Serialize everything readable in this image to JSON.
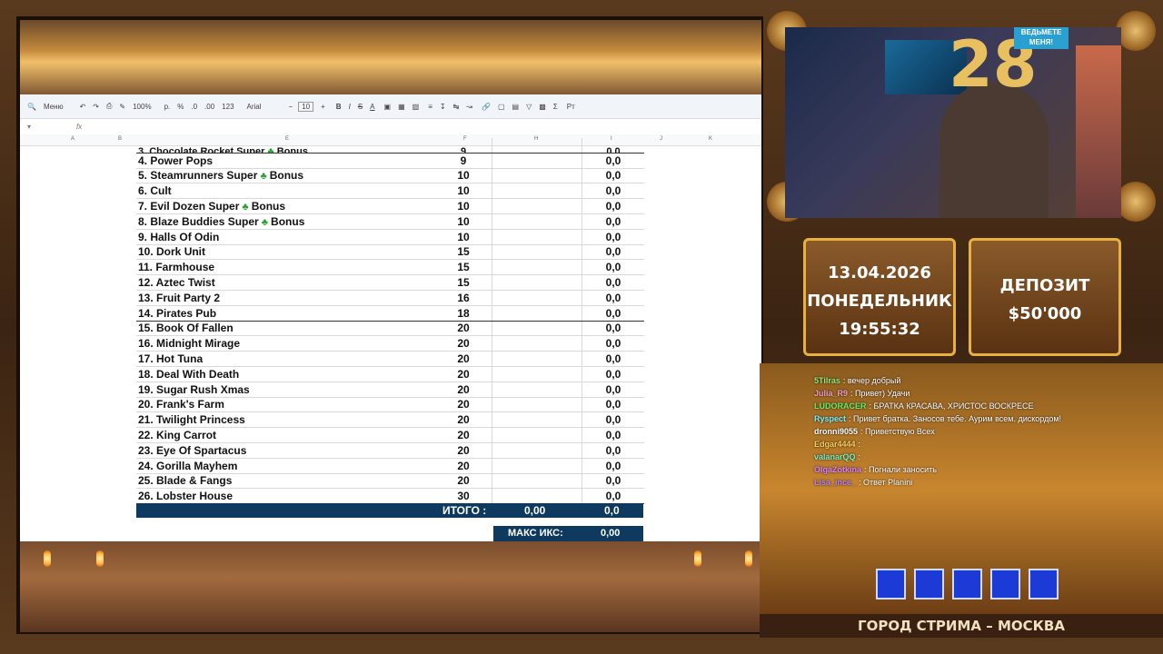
{
  "toolbar": {
    "menu_label": "Меню",
    "zoom": "100%",
    "font": "Arial",
    "font_size": "10",
    "format_123": "123"
  },
  "formula_bar": {
    "fx": "fx"
  },
  "columns": [
    "A",
    "B",
    "E",
    "F",
    "H",
    "I",
    "J",
    "K"
  ],
  "rows": [
    {
      "name": "3. Chocolate Rocket Super",
      "bonus": true,
      "bet": "9",
      "win": "",
      "x": "0,0",
      "partial": true
    },
    {
      "name": "4. Power Pops",
      "bonus": false,
      "bet": "9",
      "win": "",
      "x": "0,0"
    },
    {
      "name": "5. Steamrunners Super",
      "bonus": true,
      "bet": "10",
      "win": "",
      "x": "0,0"
    },
    {
      "name": "6. Cult",
      "bonus": false,
      "bet": "10",
      "win": "",
      "x": "0,0"
    },
    {
      "name": "7. Evil Dozen Super",
      "bonus": true,
      "bet": "10",
      "win": "",
      "x": "0,0"
    },
    {
      "name": "8. Blaze Buddies Super",
      "bonus": true,
      "bet": "10",
      "win": "",
      "x": "0,0"
    },
    {
      "name": "9. Halls Of Odin",
      "bonus": false,
      "bet": "10",
      "win": "",
      "x": "0,0"
    },
    {
      "name": "10. Dork Unit",
      "bonus": false,
      "bet": "15",
      "win": "",
      "x": "0,0"
    },
    {
      "name": "11. Farmhouse",
      "bonus": false,
      "bet": "15",
      "win": "",
      "x": "0,0"
    },
    {
      "name": "12. Aztec Twist",
      "bonus": false,
      "bet": "15",
      "win": "",
      "x": "0,0"
    },
    {
      "name": "13. Fruit Party 2",
      "bonus": false,
      "bet": "16",
      "win": "",
      "x": "0,0"
    },
    {
      "name": "14. Pirates Pub",
      "bonus": false,
      "bet": "18",
      "win": "",
      "x": "0,0"
    },
    {
      "name": "15. Book Of Fallen",
      "bonus": false,
      "bet": "20",
      "win": "",
      "x": "0,0"
    },
    {
      "name": "16. Midnight Mirage",
      "bonus": false,
      "bet": "20",
      "win": "",
      "x": "0,0"
    },
    {
      "name": "17. Hot Tuna",
      "bonus": false,
      "bet": "20",
      "win": "",
      "x": "0,0"
    },
    {
      "name": "18. Deal With Death",
      "bonus": false,
      "bet": "20",
      "win": "",
      "x": "0,0"
    },
    {
      "name": "19. Sugar Rush Xmas",
      "bonus": false,
      "bet": "20",
      "win": "",
      "x": "0,0"
    },
    {
      "name": "20. Frank's Farm",
      "bonus": false,
      "bet": "20",
      "win": "",
      "x": "0,0"
    },
    {
      "name": "21. Twilight Princess",
      "bonus": false,
      "bet": "20",
      "win": "",
      "x": "0,0"
    },
    {
      "name": "22. King Carrot",
      "bonus": false,
      "bet": "20",
      "win": "",
      "x": "0,0"
    },
    {
      "name": "23. Eye Of Spartacus",
      "bonus": false,
      "bet": "20",
      "win": "",
      "x": "0,0"
    },
    {
      "name": "24. Gorilla Mayhem",
      "bonus": false,
      "bet": "20",
      "win": "",
      "x": "0,0"
    },
    {
      "name": "25. Blade & Fangs",
      "bonus": false,
      "bet": "20",
      "win": "",
      "x": "0,0"
    },
    {
      "name": "26. Lobster House",
      "bonus": false,
      "bet": "30",
      "win": "",
      "x": "0,0"
    }
  ],
  "bonus_word": "Bonus",
  "totals": {
    "label": "ИТОГО :",
    "sum": "0,00",
    "x": "0,0"
  },
  "max_x": {
    "label": "МАКС ИКС:",
    "value": "0,00"
  },
  "webcam": {
    "balloon": "28",
    "sign": "ВЕДЬМЕТЕ МЕНЯ!"
  },
  "date_panel": {
    "date": "13.04.2026",
    "weekday": "ПОНЕДЕЛЬНИК",
    "time": "19:55:32"
  },
  "deposit_panel": {
    "label": "ДЕПОЗИТ",
    "amount": "$50'000"
  },
  "chat": [
    {
      "user": "5Tilras",
      "text": "вечер добрый",
      "color": "#8cf07a"
    },
    {
      "user": "Julia_R9",
      "text": "Привет) Удачи",
      "color": "#f0a0c0"
    },
    {
      "user": "LUDORACER",
      "text": "БРАТКА КРАСАВА, ХРИСТОС ВОСКРЕСЕ",
      "color": "#6af06a"
    },
    {
      "user": "Ryspect",
      "text": "Привет братка. Заносов тебе. Аурим всем. дискордом!",
      "color": "#7af0ff"
    },
    {
      "user": "dronni9055",
      "text": "Приветствую Всех",
      "color": "#ffffff"
    },
    {
      "user": "Edgar4444",
      "text": "",
      "color": "#ffd060"
    },
    {
      "user": "valanarQQ",
      "text": "",
      "color": "#7af0c0"
    },
    {
      "user": "OlgaZotkina",
      "text": "Погнали заносить",
      "color": "#e080ff"
    },
    {
      "user": "Lisa_ince_",
      "text": "Ответ Planini",
      "color": "#c080ff"
    }
  ],
  "city": "ГОРОД СТРИМА – МОСКВА"
}
